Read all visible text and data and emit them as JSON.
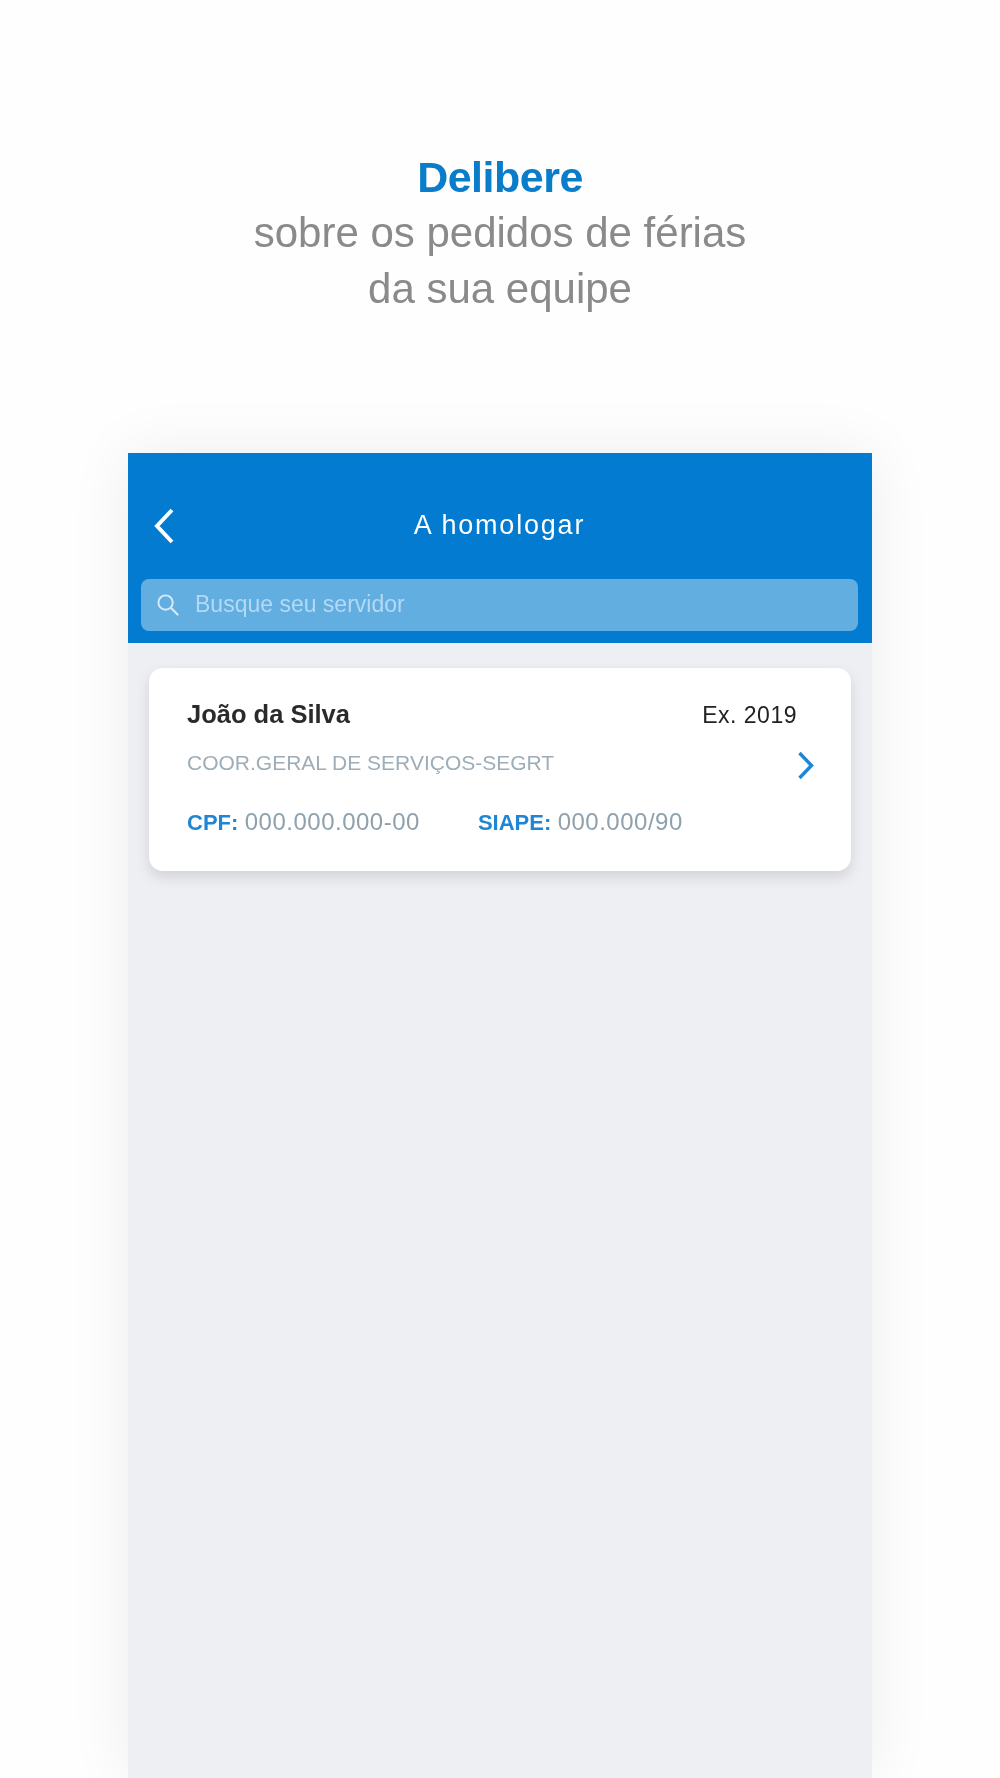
{
  "headline": {
    "title": "Delibere",
    "subtitle_lines": [
      "sobre os pedidos de férias",
      "da sua equipe"
    ]
  },
  "screen": {
    "header": {
      "title": "A homologar"
    },
    "search": {
      "placeholder": "Busque seu servidor"
    },
    "cards": [
      {
        "name": "João da Silva",
        "exercise": "Ex. 2019",
        "department": "COOR.GERAL DE SERVIÇOS-SEGRT",
        "fields": [
          {
            "label": "CPF:",
            "value": "000.000.000-00"
          },
          {
            "label": "SIAPE:",
            "value": "000.000/90"
          }
        ]
      }
    ]
  }
}
